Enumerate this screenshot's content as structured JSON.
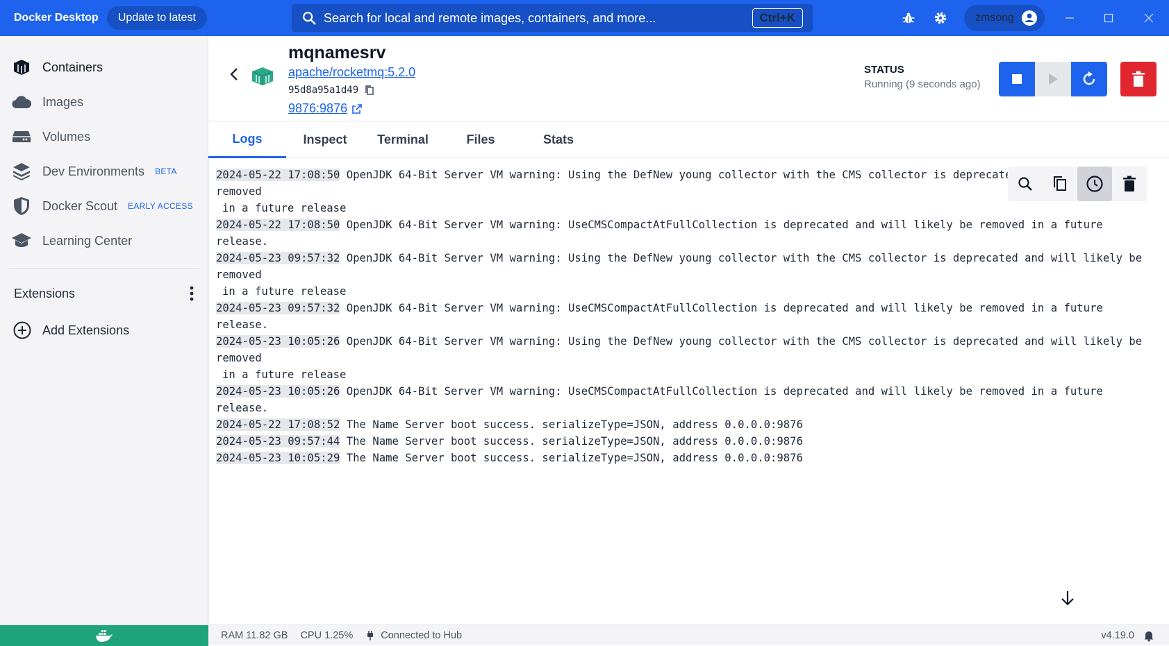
{
  "app": {
    "title": "Docker Desktop",
    "update_label": "Update to latest",
    "search_placeholder": "Search for local and remote images, containers, and more...",
    "search_shortcut": "Ctrl+K",
    "user": "zmsong"
  },
  "sidebar": {
    "items": [
      {
        "label": "Containers",
        "icon": "containers-icon",
        "active": true
      },
      {
        "label": "Images",
        "icon": "cloud-icon"
      },
      {
        "label": "Volumes",
        "icon": "volumes-icon"
      },
      {
        "label": "Dev Environments",
        "badge": "BETA",
        "icon": "dev-env-icon"
      },
      {
        "label": "Docker Scout",
        "badge": "EARLY ACCESS",
        "icon": "shield-icon"
      },
      {
        "label": "Learning Center",
        "icon": "graduation-cap-icon"
      }
    ],
    "extensions_label": "Extensions",
    "add_extensions_label": "Add Extensions"
  },
  "container": {
    "name": "mqnamesrv",
    "image": "apache/rocketmq:5.2.0",
    "id": "95d8a95a1d49",
    "port": "9876:9876",
    "status_label": "STATUS",
    "status_value": "Running (9 seconds ago)"
  },
  "tabs": [
    {
      "label": "Logs",
      "active": true
    },
    {
      "label": "Inspect"
    },
    {
      "label": "Terminal"
    },
    {
      "label": "Files"
    },
    {
      "label": "Stats"
    }
  ],
  "logs": [
    {
      "ts": "2024-05-22 17:08:50",
      "msg": "OpenJDK 64-Bit Server VM warning: Using the DefNew young collector with the CMS collector is deprecated and will likely be removed",
      "cont": "in a future release"
    },
    {
      "ts": "2024-05-22 17:08:50",
      "msg": "OpenJDK 64-Bit Server VM warning: UseCMSCompactAtFullCollection is deprecated and will likely be removed in a future release."
    },
    {
      "ts": "2024-05-23 09:57:32",
      "msg": "OpenJDK 64-Bit Server VM warning: Using the DefNew young collector with the CMS collector is deprecated and will likely be removed",
      "cont": "in a future release"
    },
    {
      "ts": "2024-05-23 09:57:32",
      "msg": "OpenJDK 64-Bit Server VM warning: UseCMSCompactAtFullCollection is deprecated and will likely be removed in a future release."
    },
    {
      "ts": "2024-05-23 10:05:26",
      "msg": "OpenJDK 64-Bit Server VM warning: Using the DefNew young collector with the CMS collector is deprecated and will likely be removed",
      "cont": "in a future release"
    },
    {
      "ts": "2024-05-23 10:05:26",
      "msg": "OpenJDK 64-Bit Server VM warning: UseCMSCompactAtFullCollection is deprecated and will likely be removed in a future release."
    },
    {
      "ts": "2024-05-22 17:08:52",
      "msg": "The Name Server boot success. serializeType=JSON, address 0.0.0.0:9876"
    },
    {
      "ts": "2024-05-23 09:57:44",
      "msg": "The Name Server boot success. serializeType=JSON, address 0.0.0.0:9876"
    },
    {
      "ts": "2024-05-23 10:05:29",
      "msg": "The Name Server boot success. serializeType=JSON, address 0.0.0.0:9876"
    }
  ],
  "footer": {
    "ram": "RAM 11.82 GB",
    "cpu": "CPU 1.25%",
    "hub": "Connected to Hub",
    "version": "v4.19.0"
  },
  "colors": {
    "accent": "#1d63ed",
    "danger": "#e2262f",
    "engine_running": "#1fa37a",
    "container_icon": "#2aa889"
  }
}
